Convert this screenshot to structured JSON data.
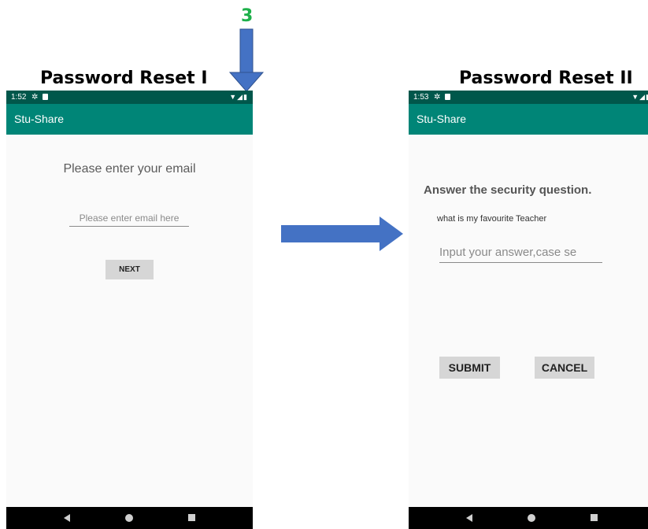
{
  "annotations": {
    "caption_left": "Password Reset I",
    "caption_right": "Password Reset II",
    "step_number": "3",
    "arrow_color": "#4472c4",
    "step_color": "#1db04a"
  },
  "screen1": {
    "status_time": "1:52",
    "app_title": "Stu-Share",
    "prompt": "Please enter your email",
    "email_placeholder": "Please enter email here",
    "next_label": "NEXT"
  },
  "screen2": {
    "status_time": "1:53",
    "app_title": "Stu-Share",
    "heading": "Answer the security question.",
    "question": "what is my favourite Teacher",
    "answer_placeholder": "Input your answer,case se",
    "submit_label": "SUBMIT",
    "cancel_label": "CANCEL"
  },
  "colors": {
    "status_bar": "#00574b",
    "app_bar": "#008577"
  }
}
